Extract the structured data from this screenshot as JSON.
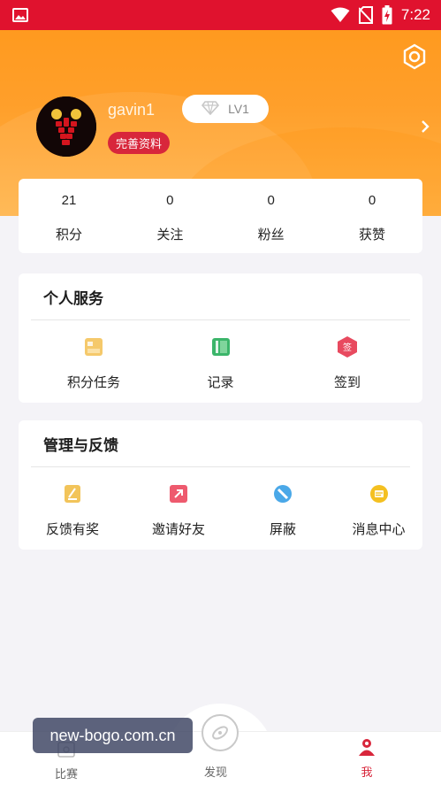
{
  "status_bar": {
    "time": "7:22"
  },
  "profile": {
    "username": "gavin1",
    "level": "LV1",
    "complete_profile_label": "完善资料"
  },
  "stats": [
    {
      "value": "21",
      "label": "积分"
    },
    {
      "value": "0",
      "label": "关注"
    },
    {
      "value": "0",
      "label": "粉丝"
    },
    {
      "value": "0",
      "label": "获赞"
    }
  ],
  "personal_services": {
    "title": "个人服务",
    "items": [
      {
        "label": "积分任务",
        "icon": "points-task-icon",
        "color": "#f5c96b"
      },
      {
        "label": "记录",
        "icon": "record-icon",
        "color": "#3bb56a"
      },
      {
        "label": "签到",
        "icon": "checkin-icon",
        "color": "#e84a5f"
      }
    ]
  },
  "management": {
    "title": "管理与反馈",
    "items": [
      {
        "label": "反馈有奖",
        "icon": "feedback-icon",
        "color": "#f2c45a"
      },
      {
        "label": "邀请好友",
        "icon": "invite-icon",
        "color": "#ee5a6e"
      },
      {
        "label": "屏蔽",
        "icon": "block-icon",
        "color": "#4aa8e8"
      },
      {
        "label": "消息中心",
        "icon": "message-center-icon",
        "color": "#f4c021"
      }
    ]
  },
  "bottom_nav": {
    "items": [
      {
        "label": "比赛",
        "icon": "match-icon"
      },
      {
        "label": "发现",
        "icon": "discover-icon"
      },
      {
        "label": "我",
        "icon": "me-icon"
      }
    ],
    "active_index": 2
  },
  "watermark": "new-bogo.com.cn",
  "colors": {
    "status_bar": "#e0122e",
    "header_gradient_start": "#ff9a1f",
    "accent_red": "#d8263b"
  }
}
